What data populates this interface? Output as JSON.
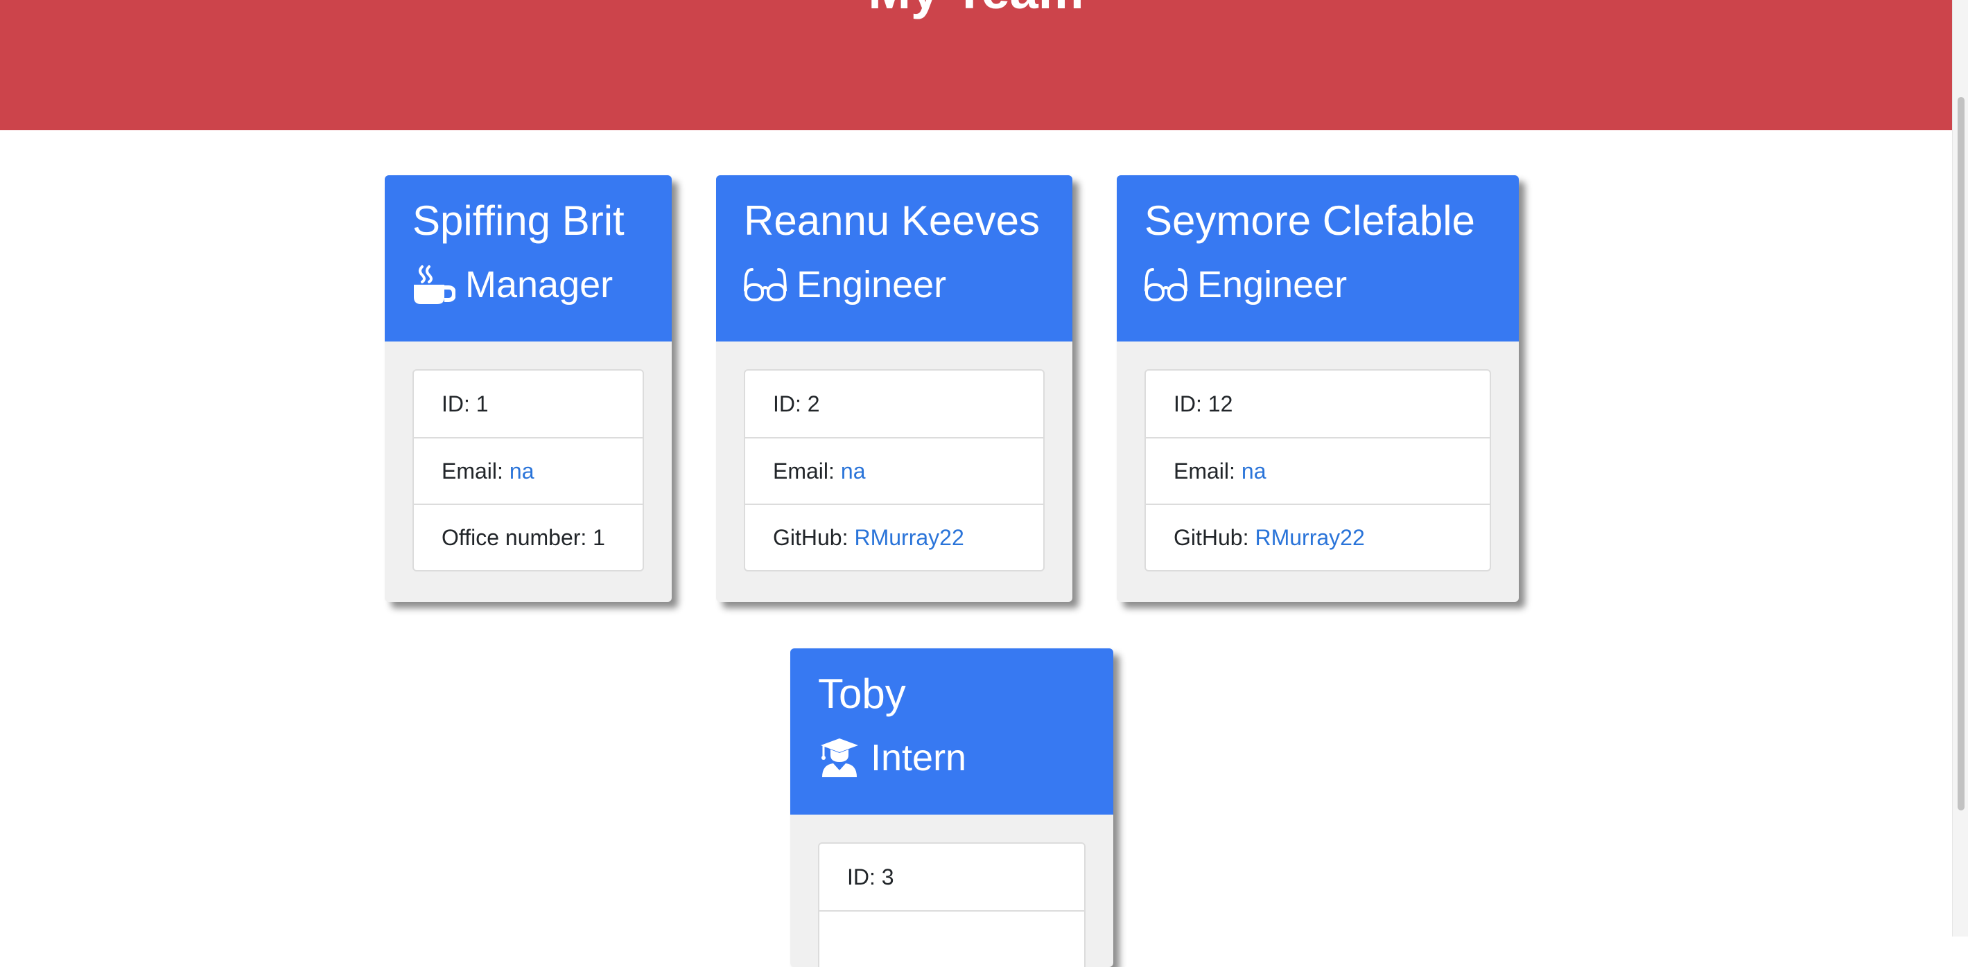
{
  "header": {
    "title": "My Team"
  },
  "colors": {
    "header": "#cc444b",
    "card_header": "#3779f2",
    "link": "#2a74d9"
  },
  "team": [
    {
      "name": "Spiffing Brit",
      "role": "Manager",
      "icon": "mug-hot-icon",
      "id_label": "ID: 1",
      "email_label": "Email:",
      "email": "na",
      "extra_label": "Office number: 1",
      "extra_link": ""
    },
    {
      "name": "Reannu Keeves",
      "role": "Engineer",
      "icon": "glasses-icon",
      "id_label": "ID: 2",
      "email_label": "Email:",
      "email": "na",
      "extra_label": "GitHub:",
      "extra_link": "RMurray22"
    },
    {
      "name": "Seymore Clefable",
      "role": "Engineer",
      "icon": "glasses-icon",
      "id_label": "ID: 12",
      "email_label": "Email:",
      "email": "na",
      "extra_label": "GitHub:",
      "extra_link": "RMurray22"
    },
    {
      "name": "Toby",
      "role": "Intern",
      "icon": "user-graduate-icon",
      "id_label": "ID: 3"
    }
  ]
}
